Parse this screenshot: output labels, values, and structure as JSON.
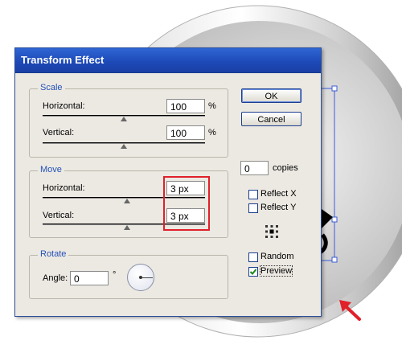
{
  "dialog": {
    "title": "Transform Effect",
    "scale": {
      "label": "Scale",
      "horizontal_label": "Horizontal:",
      "horizontal_value": "100",
      "horizontal_unit": "%",
      "vertical_label": "Vertical:",
      "vertical_value": "100",
      "vertical_unit": "%"
    },
    "move": {
      "label": "Move",
      "horizontal_label": "Horizontal:",
      "horizontal_value": "3 px",
      "vertical_label": "Vertical:",
      "vertical_value": "3 px"
    },
    "rotate": {
      "label": "Rotate",
      "angle_label": "Angle:",
      "angle_value": "0",
      "angle_unit": "°"
    },
    "buttons": {
      "ok": "OK",
      "cancel": "Cancel"
    },
    "copies": {
      "value": "0",
      "label": "copies"
    },
    "options": {
      "reflect_x": {
        "label": "Reflect X",
        "checked": false
      },
      "reflect_y": {
        "label": "Reflect Y",
        "checked": false
      },
      "random": {
        "label": "Random",
        "checked": false
      },
      "preview": {
        "label": "Preview",
        "checked": true
      }
    }
  },
  "colors": {
    "title_bar": "#2455c3",
    "group_label": "#2351b8",
    "highlight": "#e0202a",
    "arrow": "#e0202a"
  },
  "icons": [
    "reference-point-icon",
    "rotation-arrow-icon",
    "red-arrow-icon"
  ]
}
